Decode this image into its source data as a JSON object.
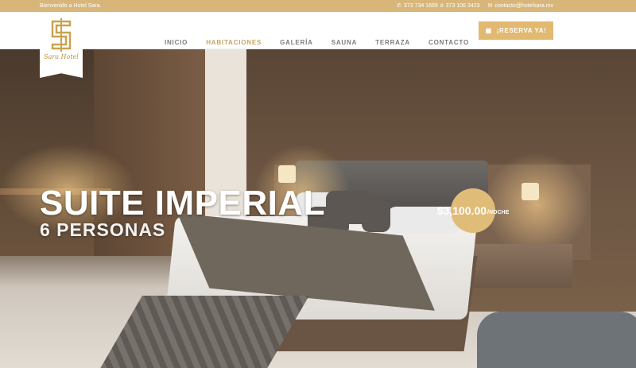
{
  "topbar": {
    "welcome": "Bienvenido a Hotel Sara.",
    "phone1": "373 734 1669",
    "separator": "ó",
    "phone2": "373 106 3423",
    "email": "contacto@hotelsara.mx"
  },
  "logo": {
    "text": "Sara Hotel"
  },
  "nav": {
    "items": [
      {
        "label": "INICIO",
        "active": false
      },
      {
        "label": "HABITACIONES",
        "active": true
      },
      {
        "label": "GALERÍA",
        "active": false
      },
      {
        "label": "SAUNA",
        "active": false
      },
      {
        "label": "TERRAZA",
        "active": false
      },
      {
        "label": "CONTACTO",
        "active": false
      }
    ],
    "reserve_label": "¡RESERVA YA!"
  },
  "hero": {
    "title": "SUITE IMPERIAL",
    "subtitle": "6 PERSONAS",
    "price": "$3,100.00",
    "price_unit": "/NOCHE"
  },
  "colors": {
    "accent": "#e1b970",
    "topbar": "#d8b67a",
    "active_nav": "#c9a466"
  },
  "icons": [
    "phone-icon",
    "mail-icon",
    "calendar-icon"
  ]
}
